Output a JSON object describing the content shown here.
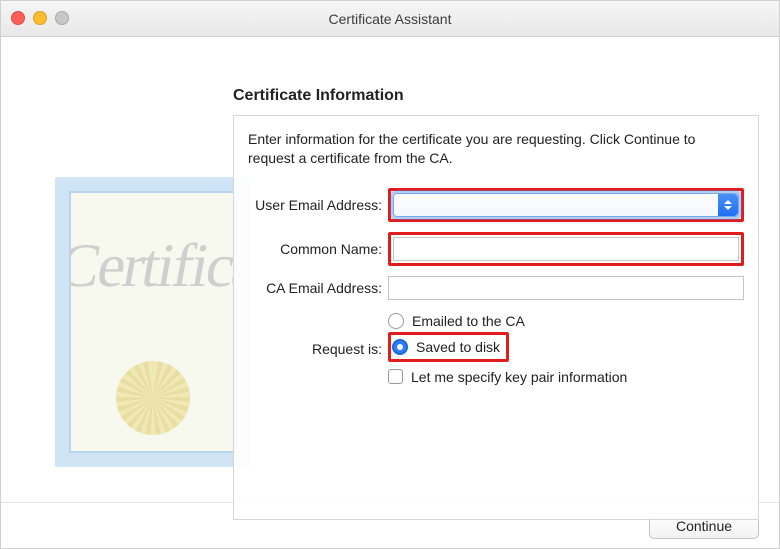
{
  "window_title": "Certificate Assistant",
  "heading": "Certificate Information",
  "intro": "Enter information for the certificate you are requesting. Click Continue to request a certificate from the CA.",
  "labels": {
    "user_email": "User Email Address:",
    "common_name": "Common Name:",
    "ca_email": "CA Email Address:",
    "request_is": "Request is:"
  },
  "values": {
    "user_email": "",
    "common_name": "",
    "ca_email": ""
  },
  "options": {
    "emailed": "Emailed to the CA",
    "saved": "Saved to disk",
    "selected": "saved",
    "keypair": "Let me specify key pair information",
    "keypair_checked": false
  },
  "buttons": {
    "continue": "Continue"
  }
}
